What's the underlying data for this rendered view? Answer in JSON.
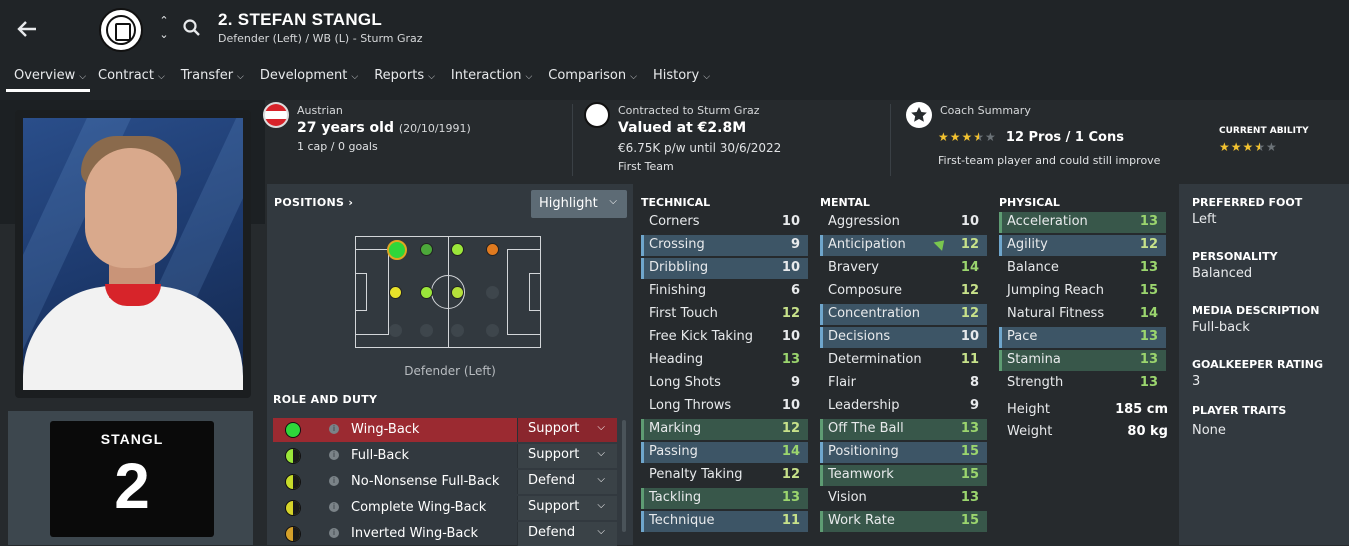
{
  "header": {
    "name": "2. STEFAN STANGL",
    "subtitle": "Defender (Left) / WB (L) - Sturm Graz"
  },
  "nav": [
    {
      "label": "Overview"
    },
    {
      "label": "Contract"
    },
    {
      "label": "Transfer"
    },
    {
      "label": "Development"
    },
    {
      "label": "Reports"
    },
    {
      "label": "Interaction"
    },
    {
      "label": "Comparison"
    },
    {
      "label": "History"
    }
  ],
  "icons": {
    "back": "back-arrow-icon",
    "search": "search-icon",
    "updown": "up-down-chevrons-icon",
    "chevron": "⌄"
  },
  "colors": {
    "accent_red": "#9b2a31",
    "attr_blue": "#3d5566",
    "attr_green": "#38574a",
    "value_green": "#9bd56e",
    "star": "#f2c230"
  },
  "info": {
    "nationality": "Austrian",
    "age": "27 years old",
    "dob": "(20/10/1991)",
    "caps": "1 cap / 0 goals",
    "contract_label": "Contracted to Sturm Graz",
    "value": "Valued at €2.8M",
    "wage": "€6.75K p/w until 30/6/2022",
    "squad": "First Team",
    "coach_label": "Coach Summary",
    "coach_stars": 3.5,
    "pros_cons": "12 Pros / 1 Cons",
    "coach_desc": "First-team player and could still improve",
    "ca_label": "CURRENT ABILITY",
    "ca_stars": 3.5
  },
  "shirt": {
    "name": "STANGL",
    "number": "2"
  },
  "positions": {
    "title": "POSITIONS ›",
    "highlight_label": "Highlight",
    "caption": "Defender (Left)",
    "role_title": "ROLE AND DUTY"
  },
  "roles": [
    {
      "name": "Wing-Back",
      "duty": "Support",
      "dot": "#2fd73a",
      "half": false
    },
    {
      "name": "Full-Back",
      "duty": "Support",
      "dot": "#9be63a",
      "half": true
    },
    {
      "name": "No-Nonsense Full-Back",
      "duty": "Defend",
      "dot": "#c7dc2a",
      "half": true
    },
    {
      "name": "Complete Wing-Back",
      "duty": "Support",
      "dot": "#d6d42a",
      "half": true
    },
    {
      "name": "Inverted Wing-Back",
      "duty": "Defend",
      "dot": "#d4a02a",
      "half": true
    }
  ],
  "attributes": {
    "technical_title": "TECHNICAL",
    "mental_title": "MENTAL",
    "physical_title": "PHYSICAL",
    "technical": [
      {
        "name": "Corners",
        "value": 10,
        "hl": ""
      },
      {
        "name": "Crossing",
        "value": 9,
        "hl": "blue"
      },
      {
        "name": "Dribbling",
        "value": 10,
        "hl": "blue"
      },
      {
        "name": "Finishing",
        "value": 6,
        "hl": ""
      },
      {
        "name": "First Touch",
        "value": 12,
        "hl": ""
      },
      {
        "name": "Free Kick Taking",
        "value": 10,
        "hl": ""
      },
      {
        "name": "Heading",
        "value": 13,
        "hl": ""
      },
      {
        "name": "Long Shots",
        "value": 9,
        "hl": ""
      },
      {
        "name": "Long Throws",
        "value": 10,
        "hl": ""
      },
      {
        "name": "Marking",
        "value": 12,
        "hl": "green"
      },
      {
        "name": "Passing",
        "value": 14,
        "hl": "blue"
      },
      {
        "name": "Penalty Taking",
        "value": 12,
        "hl": ""
      },
      {
        "name": "Tackling",
        "value": 13,
        "hl": "green"
      },
      {
        "name": "Technique",
        "value": 11,
        "hl": "blue"
      }
    ],
    "mental": [
      {
        "name": "Aggression",
        "value": 10,
        "hl": ""
      },
      {
        "name": "Anticipation",
        "value": 12,
        "hl": "blue"
      },
      {
        "name": "Bravery",
        "value": 14,
        "hl": ""
      },
      {
        "name": "Composure",
        "value": 12,
        "hl": ""
      },
      {
        "name": "Concentration",
        "value": 12,
        "hl": "blue"
      },
      {
        "name": "Decisions",
        "value": 10,
        "hl": "blue"
      },
      {
        "name": "Determination",
        "value": 11,
        "hl": ""
      },
      {
        "name": "Flair",
        "value": 8,
        "hl": ""
      },
      {
        "name": "Leadership",
        "value": 9,
        "hl": ""
      },
      {
        "name": "Off The Ball",
        "value": 13,
        "hl": "green"
      },
      {
        "name": "Positioning",
        "value": 15,
        "hl": "blue"
      },
      {
        "name": "Teamwork",
        "value": 15,
        "hl": "green"
      },
      {
        "name": "Vision",
        "value": 13,
        "hl": ""
      },
      {
        "name": "Work Rate",
        "value": 15,
        "hl": "green"
      }
    ],
    "physical": [
      {
        "name": "Acceleration",
        "value": 13,
        "hl": "green"
      },
      {
        "name": "Agility",
        "value": 12,
        "hl": "blue"
      },
      {
        "name": "Balance",
        "value": 13,
        "hl": ""
      },
      {
        "name": "Jumping Reach",
        "value": 15,
        "hl": ""
      },
      {
        "name": "Natural Fitness",
        "value": 14,
        "hl": ""
      },
      {
        "name": "Pace",
        "value": 13,
        "hl": "blue"
      },
      {
        "name": "Stamina",
        "value": 13,
        "hl": "green"
      },
      {
        "name": "Strength",
        "value": 13,
        "hl": ""
      }
    ],
    "height_label": "Height",
    "height": "185 cm",
    "weight_label": "Weight",
    "weight": "80 kg"
  },
  "side": [
    {
      "title": "PREFERRED FOOT",
      "value": "Left"
    },
    {
      "title": "PERSONALITY",
      "value": "Balanced"
    },
    {
      "title": "MEDIA DESCRIPTION",
      "value": "Full-back"
    },
    {
      "title": "GOALKEEPER RATING",
      "value": "3"
    },
    {
      "title": "PLAYER TRAITS",
      "value": "None"
    }
  ]
}
